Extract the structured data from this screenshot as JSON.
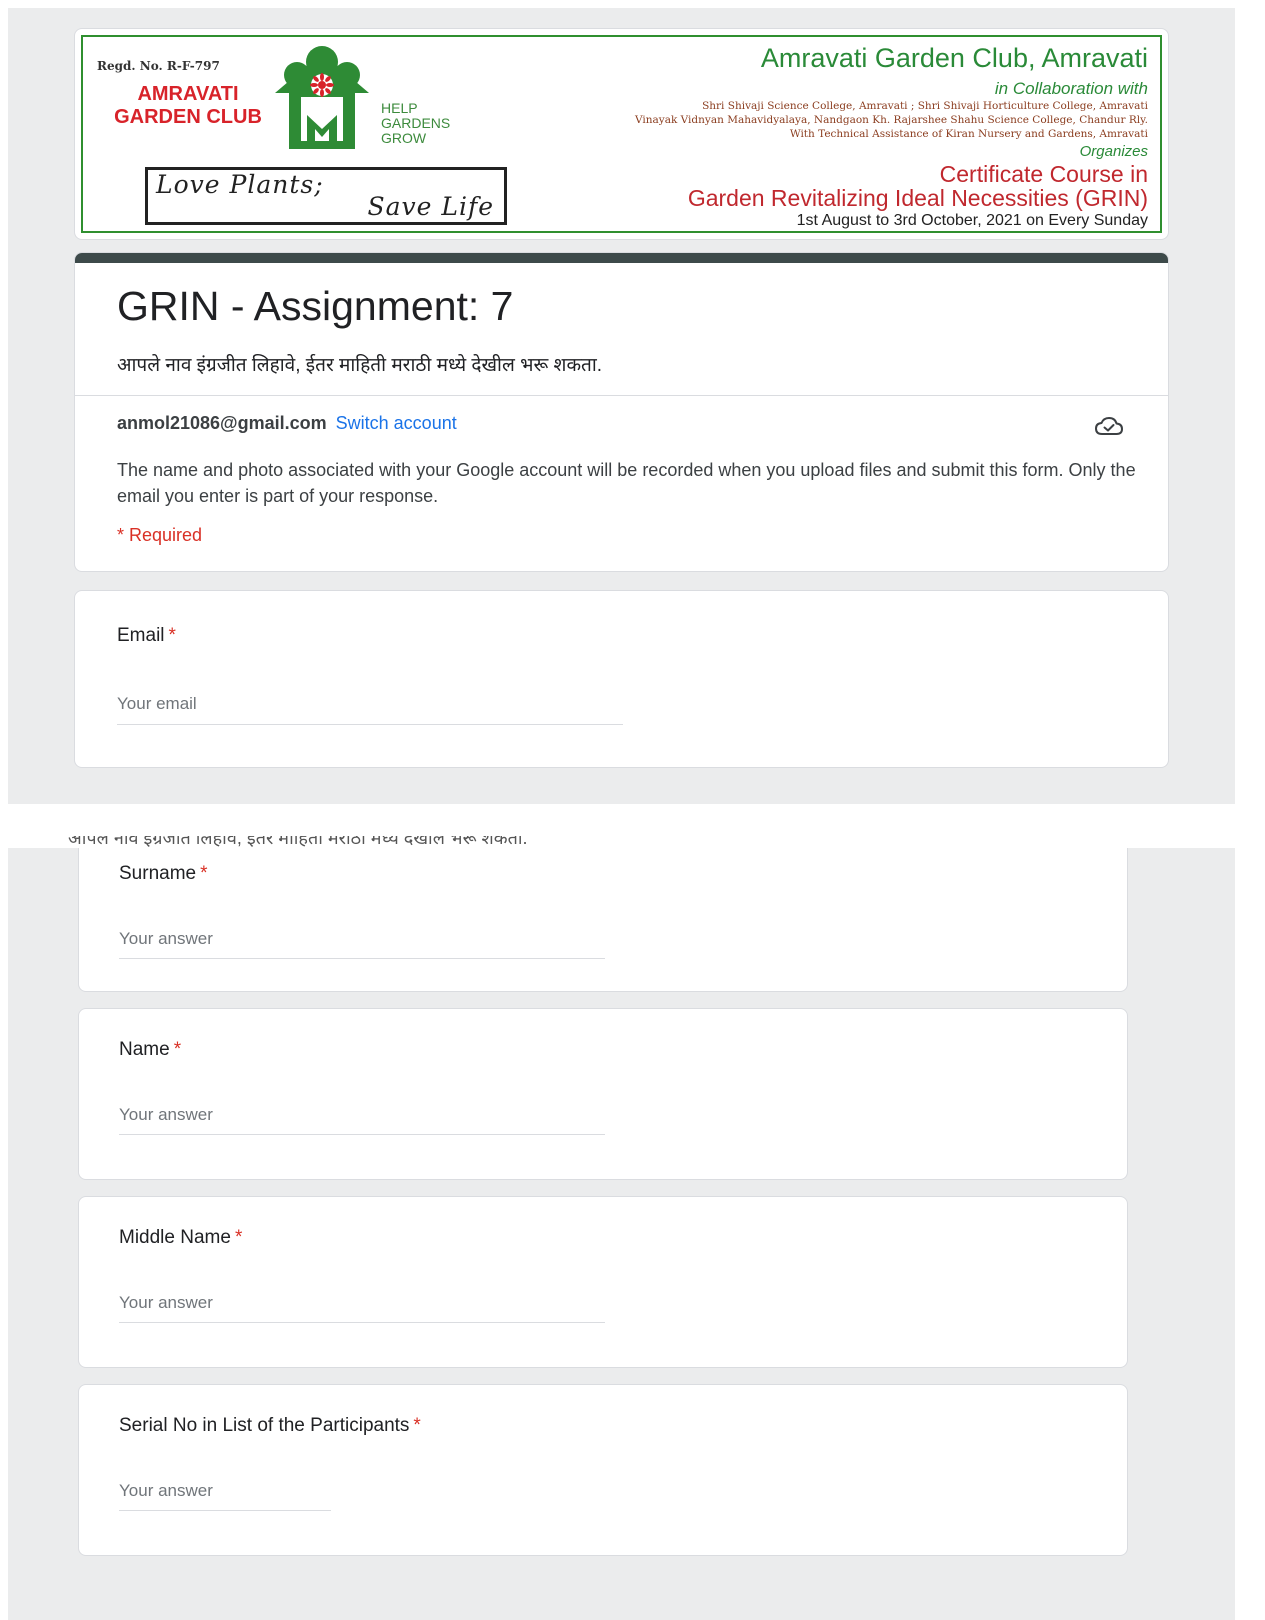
{
  "banner": {
    "regd": "Regd. No. R-F-797",
    "club_name": "AMRAVATI GARDEN CLUB",
    "help_line_1": "HELP",
    "help_line_2": "GARDENS",
    "help_line_3": "GROW",
    "slogan_1": "Love Plants;",
    "slogan_2": "Save Life",
    "title": "Amravati Garden Club, Amravati",
    "collab": "in Collaboration with",
    "line_1": "Shri Shivaji Science College, Amravati ; Shri Shivaji Horticulture College, Amravati",
    "line_2": "Vinayak Vidnyan Mahavidyalaya, Nandgaon Kh. Rajarshee Shahu Science College, Chandur Rly.",
    "line_3": "With Technical Assistance of Kiran Nursery and Gardens, Amravati",
    "organizes": "Organizes",
    "cert": "Certificate Course in",
    "course": "Garden Revitalizing Ideal Necessities (GRIN)",
    "date": "1st August to 3rd October, 2021 on Every Sunday"
  },
  "header": {
    "title": "GRIN - Assignment: 7",
    "description": "आपले नाव इंग्रजीत लिहावे, ईतर माहिती मराठी मध्ये देखील भरू शकता.",
    "account_email": "anmol21086@gmail.com",
    "switch_label": "Switch account",
    "notice": "The name and photo associated with your Google account will be recorded when you upload files and submit this form. Only the email you enter is part of your response.",
    "required": "* Required"
  },
  "questions": {
    "email": {
      "label": "Email",
      "placeholder": "Your email"
    },
    "surname": {
      "label": "Surname",
      "placeholder": "Your answer"
    },
    "name": {
      "label": "Name",
      "placeholder": "Your answer"
    },
    "middle": {
      "label": "Middle Name",
      "placeholder": "Your answer"
    },
    "serial": {
      "label": "Serial No in List of the Participants",
      "placeholder": "Your answer"
    }
  },
  "asterisk": "*",
  "colors": {
    "accent_bar": "#3d4a4a",
    "link": "#1a73e8",
    "required": "#d93025",
    "background": "#ebeced"
  }
}
